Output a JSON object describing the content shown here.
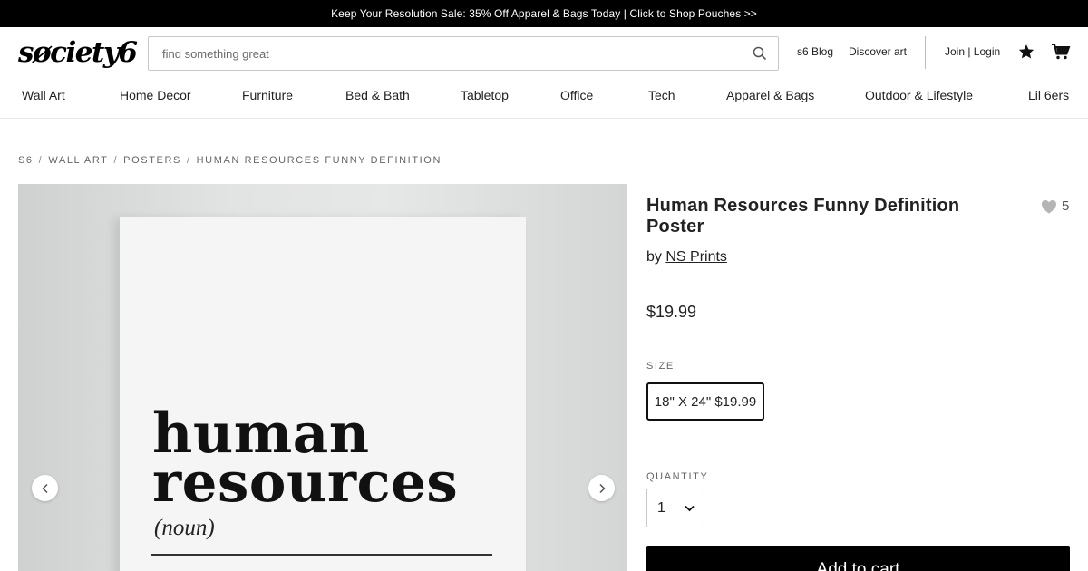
{
  "promo": {
    "text": "Keep Your Resolution Sale: 35% Off Apparel & Bags Today | Click to Shop Pouches >>"
  },
  "header": {
    "logo": "søciety6",
    "search_placeholder": "find something great",
    "links": {
      "blog": "s6 Blog",
      "discover": "Discover art",
      "join_login": "Join | Login"
    },
    "icons": {
      "search": "search-icon",
      "favorites": "star-icon",
      "cart": "cart-icon"
    }
  },
  "categories": [
    "Wall Art",
    "Home Decor",
    "Furniture",
    "Bed & Bath",
    "Tabletop",
    "Office",
    "Tech",
    "Apparel & Bags",
    "Outdoor & Lifestyle",
    "Lil 6ers"
  ],
  "breadcrumb": [
    "S6",
    "WALL ART",
    "POSTERS",
    "HUMAN RESOURCES FUNNY DEFINITION"
  ],
  "gallery": {
    "poster_line1": "human",
    "poster_line2": "resources",
    "poster_noun": "(noun)",
    "prev_icon": "chevron-left-icon",
    "next_icon": "chevron-right-icon"
  },
  "product": {
    "title": "Human Resources Funny Definition Poster",
    "by_label": "by",
    "artist": "NS Prints",
    "favorites_count": "5",
    "price": "$19.99",
    "size_label": "SIZE",
    "size_option": "18\" X 24\" $19.99",
    "quantity_label": "QUANTITY",
    "quantity_value": "1",
    "add_to_cart": "Add to cart"
  },
  "colors": {
    "promo_bg": "#000000",
    "add_to_cart_bg": "#000000",
    "text": "#222222"
  }
}
